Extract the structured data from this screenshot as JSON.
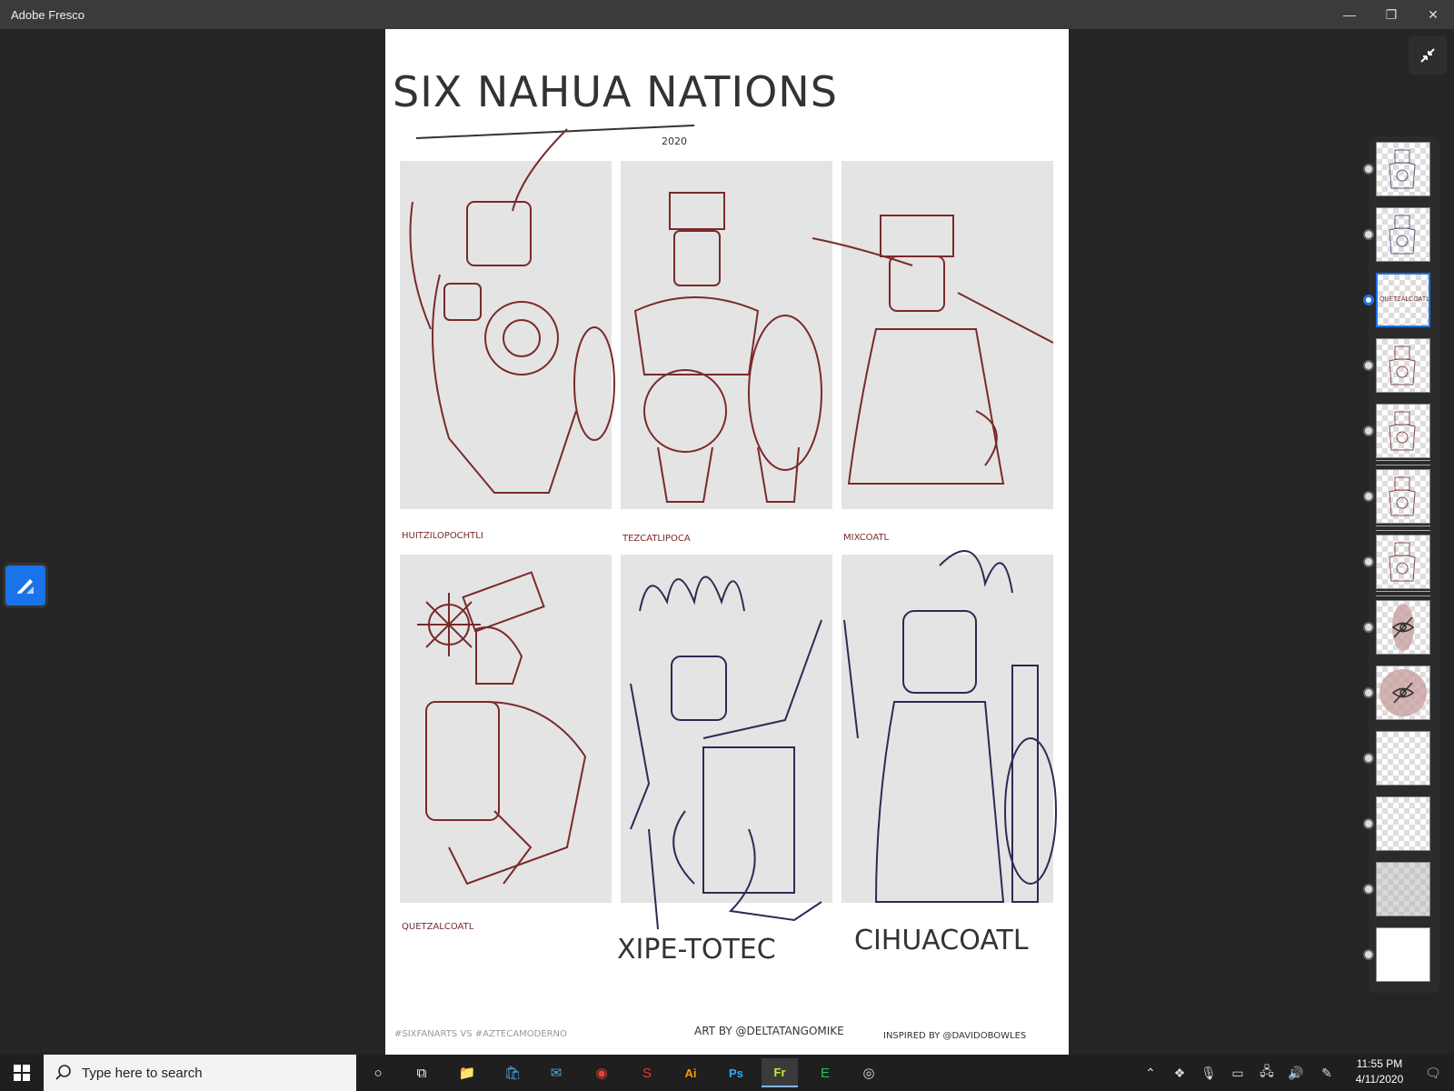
{
  "window": {
    "title": "Adobe Fresco",
    "controls": {
      "minimize": "—",
      "maximize": "❐",
      "close": "✕"
    }
  },
  "artwork": {
    "title": "SIX NAHUA NATIONS",
    "year": "2020",
    "panels": [
      {
        "label": "HUITZILOPOCHTLI"
      },
      {
        "label": "TEZCATLIPOCA"
      },
      {
        "label": "MIXCOATL"
      },
      {
        "label": "QUETZALCOATL"
      },
      {
        "label": "XIPE-TOTEC"
      },
      {
        "label": "CIHUACOATL"
      }
    ],
    "footer_left": "#SIXFANARTS VS #AZTECAMODERNO",
    "footer_mid": "ART BY @DELTATANGOMIKE",
    "footer_right": "INSPIRED BY @DAVIDOBOWLES"
  },
  "colors": {
    "accent": "#1a73e8",
    "sketch_red": "#7a2a2a",
    "ink_navy": "#2b2b55",
    "panel_gray": "#e4e4e4"
  },
  "layers": [
    {
      "name": "layer-1",
      "thumb": "figures"
    },
    {
      "name": "layer-2",
      "thumb": "figures"
    },
    {
      "name": "layer-3",
      "thumb": "text",
      "text": "QUETZALCOATL",
      "selected": true
    },
    {
      "name": "layer-4",
      "thumb": "figure"
    },
    {
      "name": "layer-5",
      "thumb": "figure",
      "group": true
    },
    {
      "name": "layer-6",
      "thumb": "figure",
      "group": true
    },
    {
      "name": "layer-7",
      "thumb": "figure",
      "group": true
    },
    {
      "name": "layer-8",
      "thumb": "hidden"
    },
    {
      "name": "layer-9",
      "thumb": "hidden"
    },
    {
      "name": "layer-10",
      "thumb": "empty"
    },
    {
      "name": "layer-11",
      "thumb": "empty"
    },
    {
      "name": "layer-12",
      "thumb": "gray"
    },
    {
      "name": "layer-13",
      "thumb": "white"
    }
  ],
  "taskbar": {
    "search_placeholder": "Type here to search",
    "apps": [
      {
        "name": "cortana-icon",
        "glyph": "○"
      },
      {
        "name": "task-view-icon",
        "glyph": "⧉"
      },
      {
        "name": "file-explorer-icon",
        "glyph": "📁"
      },
      {
        "name": "store-icon",
        "glyph": "🛍"
      },
      {
        "name": "mail-icon",
        "glyph": "✉"
      },
      {
        "name": "chrome-icon",
        "glyph": "◉"
      },
      {
        "name": "app-s-icon",
        "glyph": "S"
      },
      {
        "name": "illustrator-icon",
        "glyph": "Ai"
      },
      {
        "name": "photoshop-icon",
        "glyph": "Ps"
      },
      {
        "name": "fresco-icon",
        "glyph": "Fr"
      },
      {
        "name": "evernote-icon",
        "glyph": "E"
      },
      {
        "name": "obs-icon",
        "glyph": "◎"
      }
    ],
    "time": "11:55 PM",
    "date": "4/11/2020"
  }
}
